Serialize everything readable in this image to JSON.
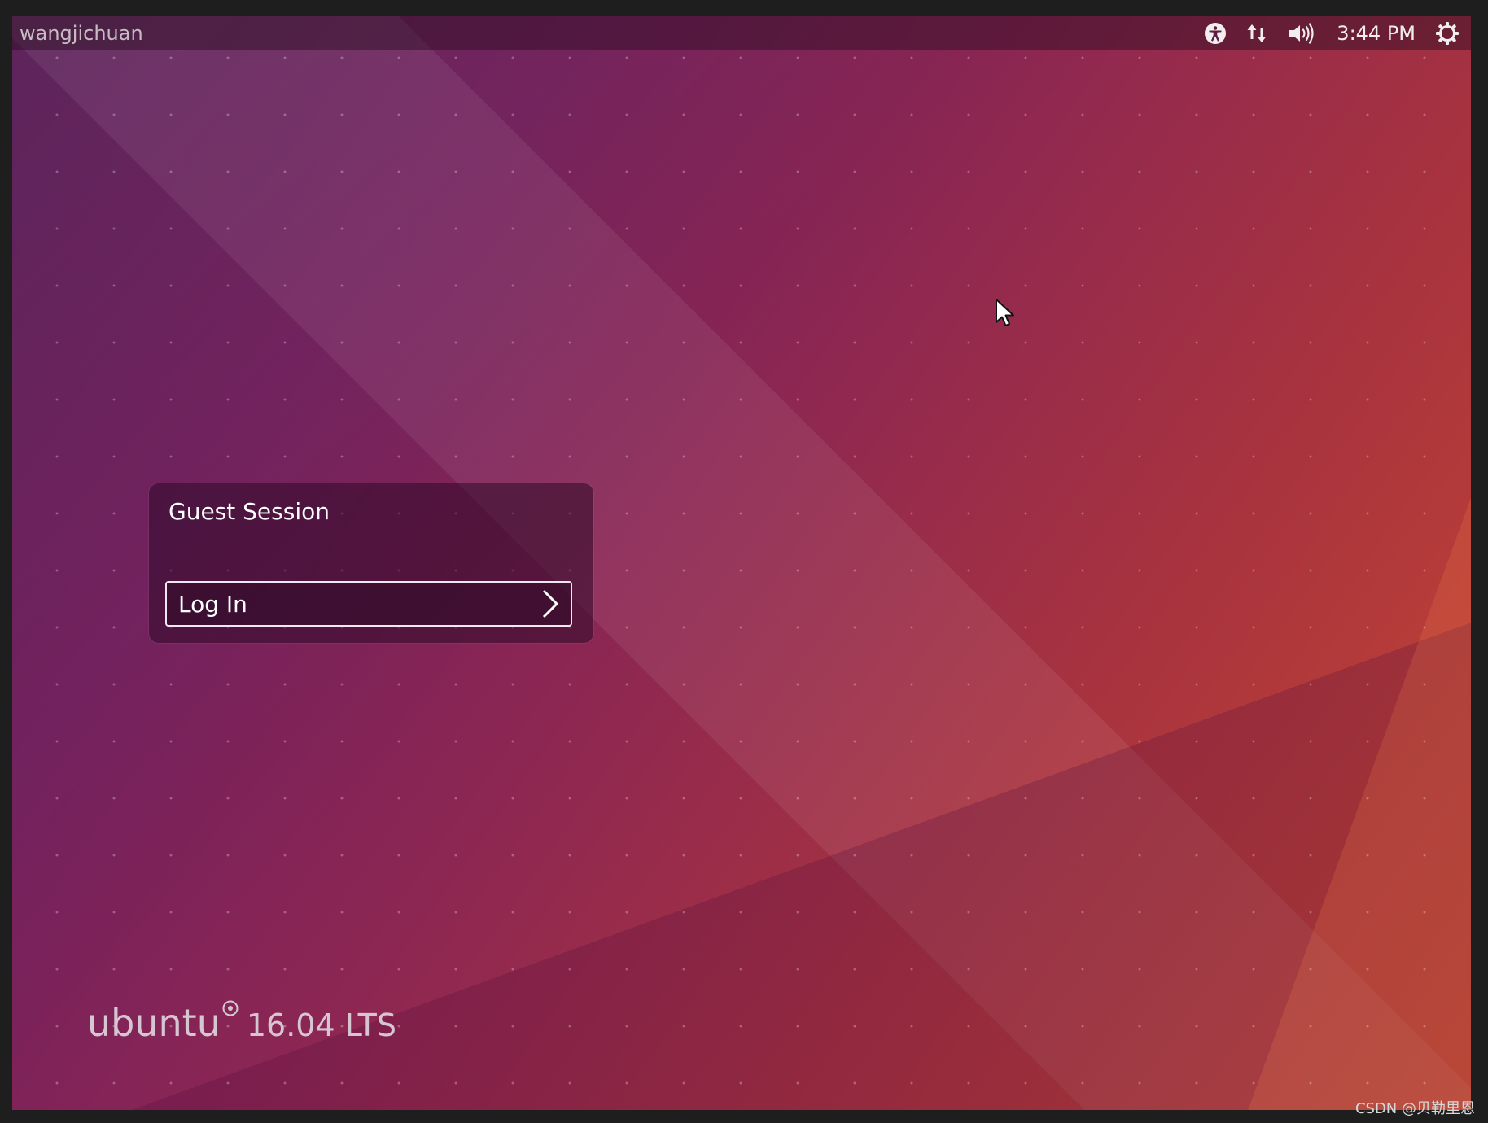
{
  "topbar": {
    "hostname": "wangjichuan",
    "clock": "3:44 PM",
    "indicators": [
      "accessibility-icon",
      "network-icon",
      "volume-icon",
      "power-icon"
    ]
  },
  "greeter": {
    "user": "Guest Session",
    "login_label": "Log In"
  },
  "brand": {
    "word": "ubuntu",
    "version": "16.04 LTS"
  },
  "watermark": "CSDN @贝勒里恩",
  "colors": {
    "bg_start": "#5e1a5c",
    "bg_end": "#c8482f",
    "text": "#ffffff"
  }
}
